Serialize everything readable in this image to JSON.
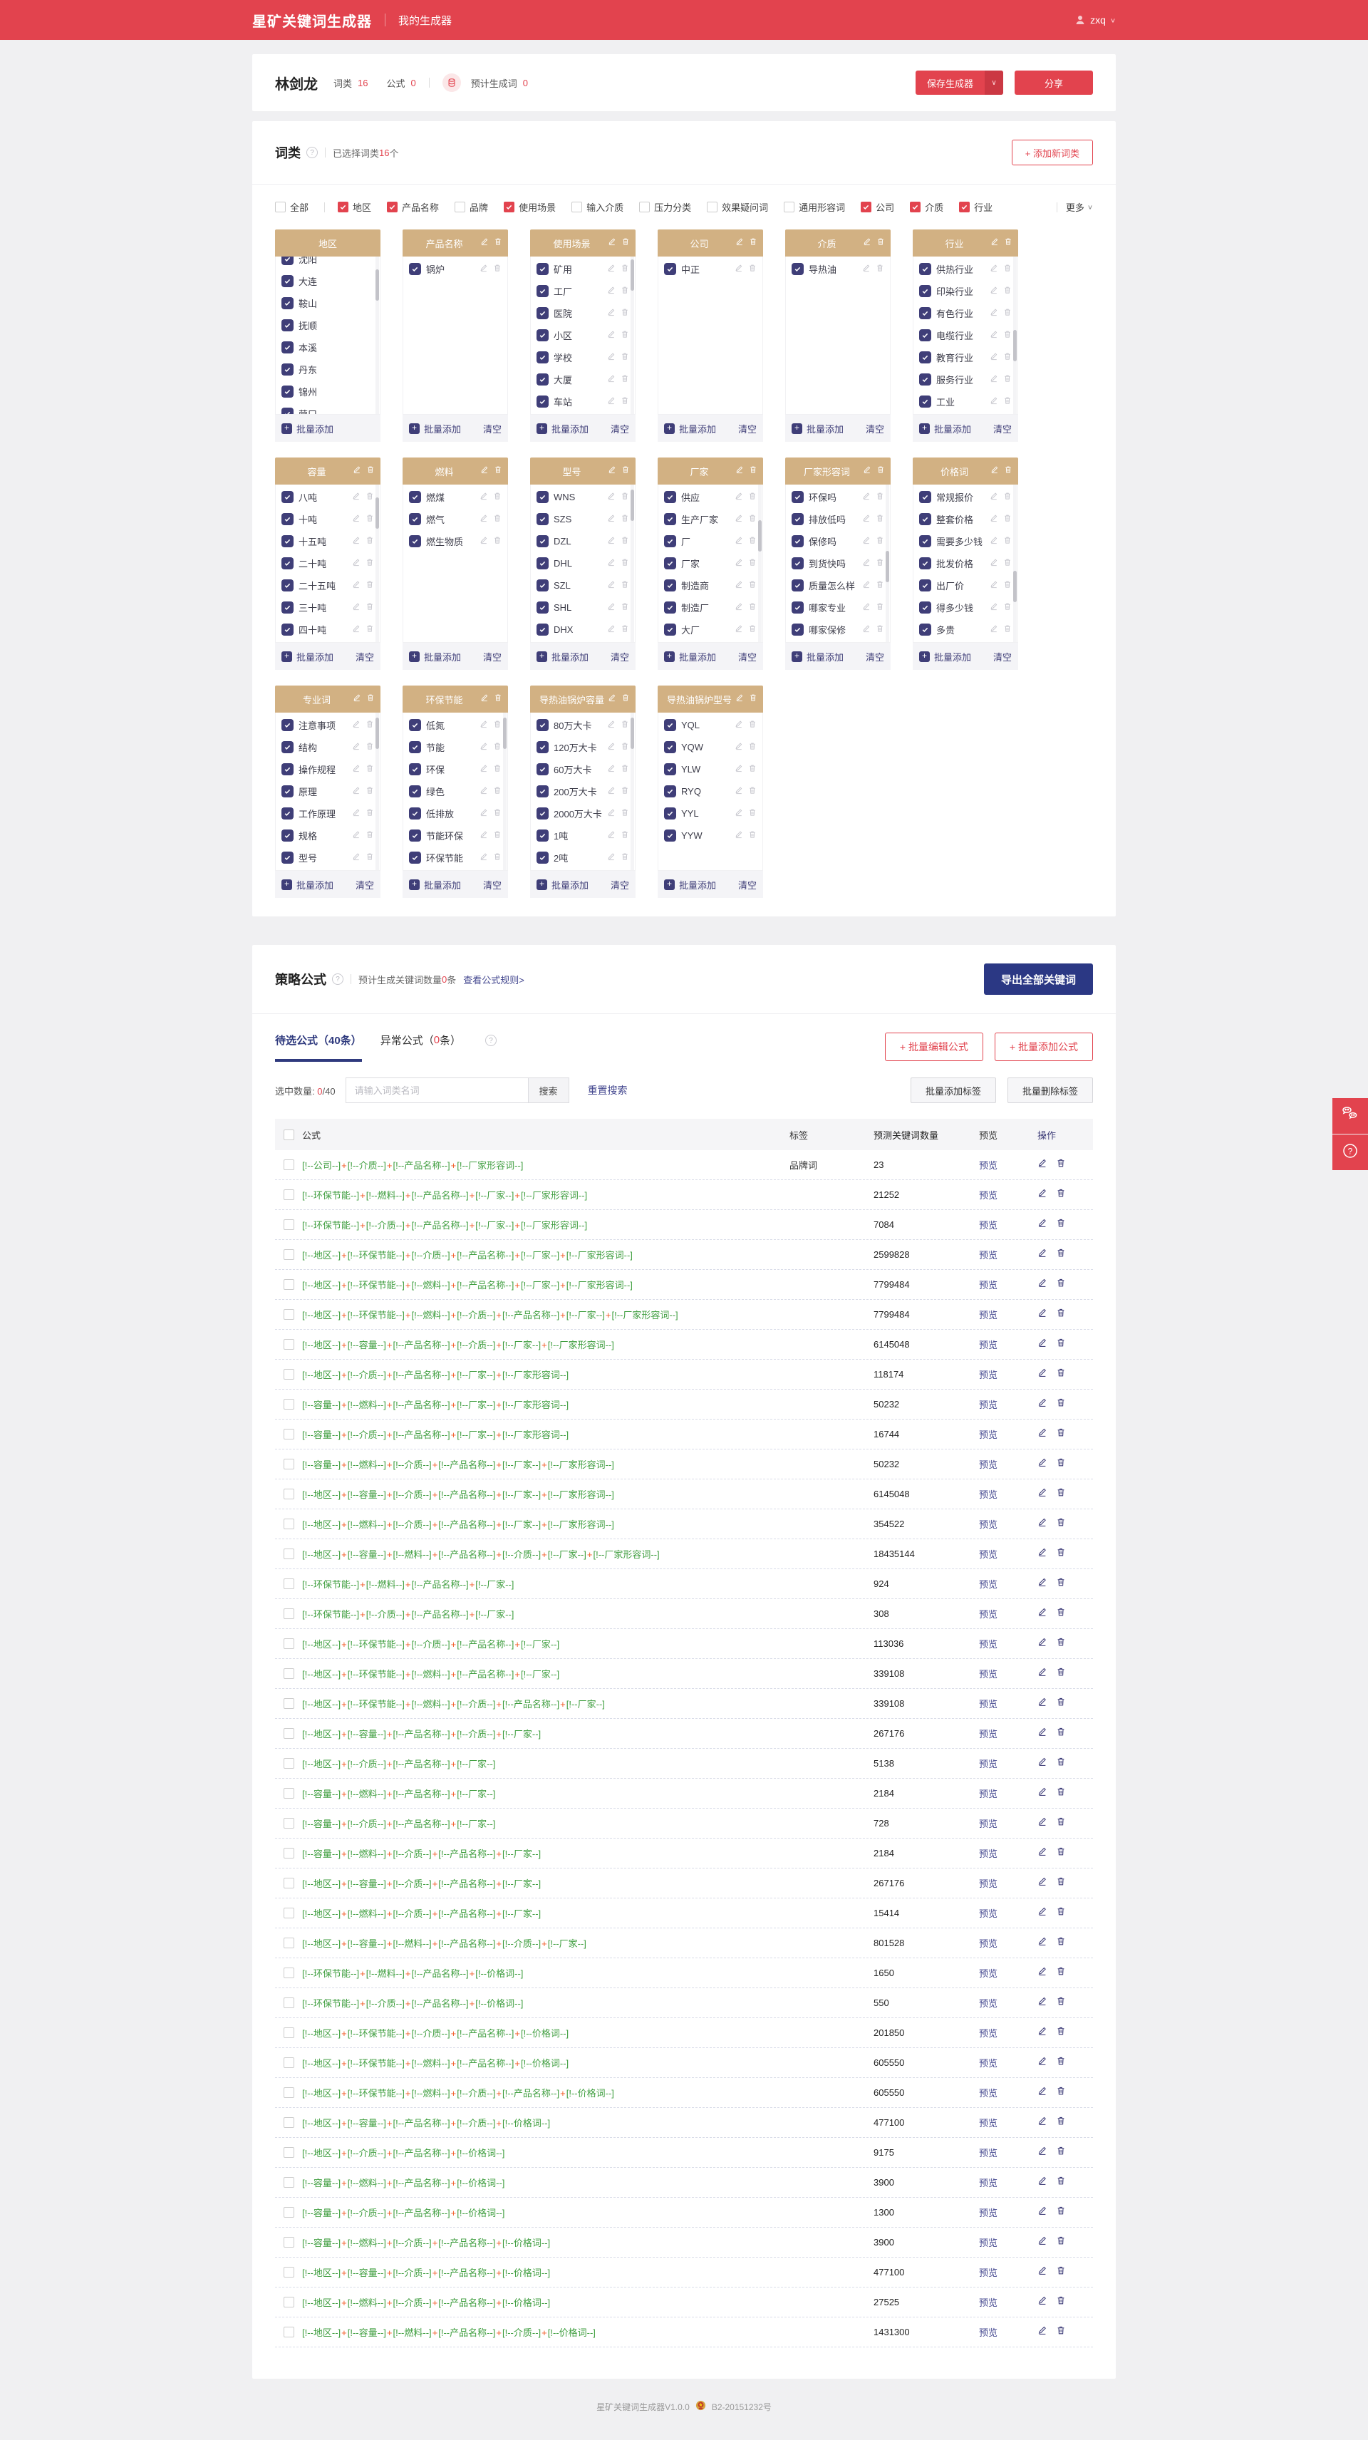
{
  "header": {
    "brand": "星矿关键词生成器",
    "nav": "我的生成器",
    "user": "zxq"
  },
  "summary": {
    "name": "林剑龙",
    "stat1_label": "词类",
    "stat1_value": "16",
    "stat2_label": "公式",
    "stat2_value": "0",
    "est_label": "预计生成词",
    "est_value": "0",
    "save_label": "保存生成器",
    "share_label": "分享"
  },
  "wordclass": {
    "title": "词类",
    "selected_prefix": "已选择词类",
    "selected_count": "16",
    "selected_suffix": "个",
    "add_button": "+ 添加新词类",
    "more_label": "更多",
    "filters": [
      {
        "label": "全部",
        "checked": false,
        "divider_after": true
      },
      {
        "label": "地区",
        "checked": true
      },
      {
        "label": "产品名称",
        "checked": true
      },
      {
        "label": "品牌",
        "checked": false
      },
      {
        "label": "使用场景",
        "checked": true
      },
      {
        "label": "输入介质",
        "checked": false
      },
      {
        "label": "压力分类",
        "checked": false
      },
      {
        "label": "效果疑问词",
        "checked": false
      },
      {
        "label": "通用形容词",
        "checked": false
      },
      {
        "label": "公司",
        "checked": true
      },
      {
        "label": "介质",
        "checked": true
      },
      {
        "label": "行业",
        "checked": true
      }
    ],
    "card_footer": {
      "add_label": "批量添加",
      "clear_label": "清空"
    },
    "cards": [
      {
        "title": "地区",
        "header_icons": false,
        "item_icons": false,
        "clear": false,
        "offset": -14,
        "scroll": 0.1,
        "items": [
          "沈阳",
          "大连",
          "鞍山",
          "抚顺",
          "本溪",
          "丹东",
          "锦州",
          "营口"
        ]
      },
      {
        "title": "产品名称",
        "items": [
          "锅炉"
        ]
      },
      {
        "title": "使用场景",
        "scroll": 0.02,
        "items": [
          "矿用",
          "工厂",
          "医院",
          "小区",
          "学校",
          "大厦",
          "车站"
        ]
      },
      {
        "title": "公司",
        "items": [
          "中正"
        ]
      },
      {
        "title": "介质",
        "items": [
          "导热油"
        ]
      },
      {
        "title": "行业",
        "scroll": 0.58,
        "items": [
          "供热行业",
          "印染行业",
          "有色行业",
          "电缆行业",
          "教育行业",
          "服务行业",
          "工业"
        ]
      },
      {
        "title": "容量",
        "scroll": 0.1,
        "items": [
          "八吨",
          "十吨",
          "十五吨",
          "二十吨",
          "二十五吨",
          "三十吨",
          "四十吨"
        ]
      },
      {
        "title": "燃料",
        "items": [
          "燃煤",
          "燃气",
          "燃生物质"
        ]
      },
      {
        "title": "型号",
        "scroll": 0.04,
        "items": [
          "WNS",
          "SZS",
          "DZL",
          "DHL",
          "SZL",
          "SHL",
          "DHX"
        ]
      },
      {
        "title": "厂家",
        "scroll": 0.28,
        "items": [
          "供应",
          "生产厂家",
          "厂",
          "厂家",
          "制造商",
          "制造厂",
          "大厂"
        ]
      },
      {
        "title": "厂家形容词",
        "scroll": 0.52,
        "items": [
          "环保吗",
          "排放低吗",
          "保修吗",
          "到货快吗",
          "质量怎么样",
          "哪家专业",
          "哪家保修"
        ]
      },
      {
        "title": "价格词",
        "scroll": 0.68,
        "items": [
          "常规报价",
          "整套价格",
          "需要多少钱",
          "批发价格",
          "出厂价",
          "得多少钱",
          "多贵"
        ]
      },
      {
        "title": "专业词",
        "scroll": 0.04,
        "items": [
          "注意事项",
          "结构",
          "操作规程",
          "原理",
          "工作原理",
          "规格",
          "型号"
        ]
      },
      {
        "title": "环保节能",
        "scroll": 0.04,
        "items": [
          "低氮",
          "节能",
          "环保",
          "绿色",
          "低排放",
          "节能环保",
          "环保节能"
        ]
      },
      {
        "title": "导热油锅炉容量",
        "scroll": 0.04,
        "items": [
          "80万大卡",
          "120万大卡",
          "60万大卡",
          "200万大卡",
          "2000万大卡",
          "1吨",
          "2吨"
        ]
      },
      {
        "title": "导热油锅炉型号",
        "items": [
          "YQL",
          "YQW",
          "YLW",
          "RYQ",
          "YYL",
          "YYW"
        ]
      }
    ]
  },
  "formula": {
    "title": "策略公式",
    "est_prefix": "预计生成关键词数量",
    "est_count": "0",
    "est_suffix": "条",
    "rules_link": "查看公式规则>",
    "export_button": "导出全部关键词",
    "tab1": "待选公式（40条）",
    "tab2_prefix": "异常公式（",
    "tab2_count": "0",
    "tab2_suffix": "条）",
    "edit_batch_button": "+ 批量编辑公式",
    "add_batch_button": "+ 批量添加公式",
    "selected_label": "选中数量:",
    "selected_zero": "0",
    "selected_total": "/40",
    "search_placeholder": "请输入词类名词",
    "search_button": "搜索",
    "reset_button": "重置搜索",
    "add_tag_button": "批量添加标签",
    "del_tag_button": "批量删除标签",
    "table": {
      "headers": [
        "公式",
        "标签",
        "预测关键词数量",
        "预览",
        "操作"
      ],
      "preview_label": "预览",
      "part_prefix": "[!--",
      "part_suffix": "--]",
      "separator": "+",
      "rows": [
        {
          "parts": [
            "公司",
            "介质",
            "产品名称",
            "厂家形容词"
          ],
          "tag": "品牌词",
          "count": "23"
        },
        {
          "parts": [
            "环保节能",
            "燃料",
            "产品名称",
            "厂家",
            "厂家形容词"
          ],
          "tag": "",
          "count": "21252"
        },
        {
          "parts": [
            "环保节能",
            "介质",
            "产品名称",
            "厂家",
            "厂家形容词"
          ],
          "tag": "",
          "count": "7084"
        },
        {
          "parts": [
            "地区",
            "环保节能",
            "介质",
            "产品名称",
            "厂家",
            "厂家形容词"
          ],
          "tag": "",
          "count": "2599828"
        },
        {
          "parts": [
            "地区",
            "环保节能",
            "燃料",
            "产品名称",
            "厂家",
            "厂家形容词"
          ],
          "tag": "",
          "count": "7799484"
        },
        {
          "parts": [
            "地区",
            "环保节能",
            "燃料",
            "介质",
            "产品名称",
            "厂家",
            "厂家形容词"
          ],
          "tag": "",
          "count": "7799484"
        },
        {
          "parts": [
            "地区",
            "容量",
            "产品名称",
            "介质",
            "厂家",
            "厂家形容词"
          ],
          "tag": "",
          "count": "6145048"
        },
        {
          "parts": [
            "地区",
            "介质",
            "产品名称",
            "厂家",
            "厂家形容词"
          ],
          "tag": "",
          "count": "118174"
        },
        {
          "parts": [
            "容量",
            "燃料",
            "产品名称",
            "厂家",
            "厂家形容词"
          ],
          "tag": "",
          "count": "50232"
        },
        {
          "parts": [
            "容量",
            "介质",
            "产品名称",
            "厂家",
            "厂家形容词"
          ],
          "tag": "",
          "count": "16744"
        },
        {
          "parts": [
            "容量",
            "燃料",
            "介质",
            "产品名称",
            "厂家",
            "厂家形容词"
          ],
          "tag": "",
          "count": "50232"
        },
        {
          "parts": [
            "地区",
            "容量",
            "介质",
            "产品名称",
            "厂家",
            "厂家形容词"
          ],
          "tag": "",
          "count": "6145048"
        },
        {
          "parts": [
            "地区",
            "燃料",
            "介质",
            "产品名称",
            "厂家",
            "厂家形容词"
          ],
          "tag": "",
          "count": "354522"
        },
        {
          "parts": [
            "地区",
            "容量",
            "燃料",
            "产品名称",
            "介质",
            "厂家",
            "厂家形容词"
          ],
          "tag": "",
          "count": "18435144"
        },
        {
          "parts": [
            "环保节能",
            "燃料",
            "产品名称",
            "厂家"
          ],
          "tag": "",
          "count": "924"
        },
        {
          "parts": [
            "环保节能",
            "介质",
            "产品名称",
            "厂家"
          ],
          "tag": "",
          "count": "308"
        },
        {
          "parts": [
            "地区",
            "环保节能",
            "介质",
            "产品名称",
            "厂家"
          ],
          "tag": "",
          "count": "113036"
        },
        {
          "parts": [
            "地区",
            "环保节能",
            "燃料",
            "产品名称",
            "厂家"
          ],
          "tag": "",
          "count": "339108"
        },
        {
          "parts": [
            "地区",
            "环保节能",
            "燃料",
            "介质",
            "产品名称",
            "厂家"
          ],
          "tag": "",
          "count": "339108"
        },
        {
          "parts": [
            "地区",
            "容量",
            "产品名称",
            "介质",
            "厂家"
          ],
          "tag": "",
          "count": "267176"
        },
        {
          "parts": [
            "地区",
            "介质",
            "产品名称",
            "厂家"
          ],
          "tag": "",
          "count": "5138"
        },
        {
          "parts": [
            "容量",
            "燃料",
            "产品名称",
            "厂家"
          ],
          "tag": "",
          "count": "2184"
        },
        {
          "parts": [
            "容量",
            "介质",
            "产品名称",
            "厂家"
          ],
          "tag": "",
          "count": "728"
        },
        {
          "parts": [
            "容量",
            "燃料",
            "介质",
            "产品名称",
            "厂家"
          ],
          "tag": "",
          "count": "2184"
        },
        {
          "parts": [
            "地区",
            "容量",
            "介质",
            "产品名称",
            "厂家"
          ],
          "tag": "",
          "count": "267176"
        },
        {
          "parts": [
            "地区",
            "燃料",
            "介质",
            "产品名称",
            "厂家"
          ],
          "tag": "",
          "count": "15414"
        },
        {
          "parts": [
            "地区",
            "容量",
            "燃料",
            "产品名称",
            "介质",
            "厂家"
          ],
          "tag": "",
          "count": "801528"
        },
        {
          "parts": [
            "环保节能",
            "燃料",
            "产品名称",
            "价格词"
          ],
          "tag": "",
          "count": "1650"
        },
        {
          "parts": [
            "环保节能",
            "介质",
            "产品名称",
            "价格词"
          ],
          "tag": "",
          "count": "550"
        },
        {
          "parts": [
            "地区",
            "环保节能",
            "介质",
            "产品名称",
            "价格词"
          ],
          "tag": "",
          "count": "201850"
        },
        {
          "parts": [
            "地区",
            "环保节能",
            "燃料",
            "产品名称",
            "价格词"
          ],
          "tag": "",
          "count": "605550"
        },
        {
          "parts": [
            "地区",
            "环保节能",
            "燃料",
            "介质",
            "产品名称",
            "价格词"
          ],
          "tag": "",
          "count": "605550"
        },
        {
          "parts": [
            "地区",
            "容量",
            "产品名称",
            "介质",
            "价格词"
          ],
          "tag": "",
          "count": "477100"
        },
        {
          "parts": [
            "地区",
            "介质",
            "产品名称",
            "价格词"
          ],
          "tag": "",
          "count": "9175"
        },
        {
          "parts": [
            "容量",
            "燃料",
            "产品名称",
            "价格词"
          ],
          "tag": "",
          "count": "3900"
        },
        {
          "parts": [
            "容量",
            "介质",
            "产品名称",
            "价格词"
          ],
          "tag": "",
          "count": "1300"
        },
        {
          "parts": [
            "容量",
            "燃料",
            "介质",
            "产品名称",
            "价格词"
          ],
          "tag": "",
          "count": "3900"
        },
        {
          "parts": [
            "地区",
            "容量",
            "介质",
            "产品名称",
            "价格词"
          ],
          "tag": "",
          "count": "477100"
        },
        {
          "parts": [
            "地区",
            "燃料",
            "介质",
            "产品名称",
            "价格词"
          ],
          "tag": "",
          "count": "27525"
        },
        {
          "parts": [
            "地区",
            "容量",
            "燃料",
            "产品名称",
            "介质",
            "价格词"
          ],
          "tag": "",
          "count": "1431300"
        }
      ]
    }
  },
  "page_footer": {
    "version": "星矿关键词生成器V1.0.0",
    "icp": "B2-20151232号"
  },
  "colors": {
    "accent_red": "#e2434e",
    "navy": "#3e3d78",
    "tan": "#d2b183",
    "green": "#3f9e3f",
    "orange": "#f25a24",
    "export_navy": "#2b3884"
  }
}
